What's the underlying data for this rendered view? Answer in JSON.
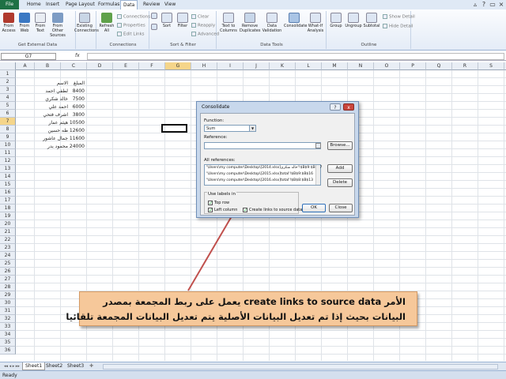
{
  "ribbon_tabs": [
    "File",
    "Home",
    "Insert",
    "Page Layout",
    "Formulas",
    "Data",
    "Review",
    "View"
  ],
  "ribbon": {
    "groups": {
      "get_external_data": "Get External Data",
      "connections": "Connections",
      "sort_filter": "Sort & Filter",
      "data_tools": "Data Tools",
      "outline": "Outline"
    },
    "buttons": {
      "from_access": "From Access",
      "from_web": "From Web",
      "from_text": "From Text",
      "from_other": "From Other Sources",
      "existing_connections": "Existing Connections",
      "refresh_all": "Refresh All",
      "sort": "Sort",
      "filter": "Filter",
      "text_to_columns": "Text to Columns",
      "remove_duplicates": "Remove Duplicates",
      "data_validation": "Data Validation",
      "consolidate": "Consolidate",
      "what_if": "What-If Analysis",
      "group": "Group",
      "ungroup": "Ungroup",
      "subtotal": "Subtotal"
    },
    "small": {
      "connections": "Connections",
      "properties": "Properties",
      "edit_links": "Edit Links",
      "clear": "Clear",
      "reapply": "Reapply",
      "advanced": "Advanced",
      "show_detail": "Show Detail",
      "hide_detail": "Hide Detail"
    }
  },
  "name_box": "G7",
  "fx": "fx",
  "columns": [
    "A",
    "B",
    "C",
    "D",
    "E",
    "F",
    "G",
    "H",
    "I",
    "J",
    "K",
    "L",
    "M",
    "N",
    "O",
    "P",
    "Q",
    "R",
    "S",
    "T"
  ],
  "rows": [
    "1",
    "2",
    "3",
    "4",
    "5",
    "6",
    "7",
    "8",
    "9",
    "10",
    "11",
    "12",
    "13",
    "14",
    "15",
    "16",
    "17",
    "18",
    "19",
    "20",
    "21",
    "22",
    "23",
    "24",
    "25",
    "26",
    "27",
    "28",
    "29",
    "30",
    "31",
    "32",
    "33",
    "34",
    "35",
    "36"
  ],
  "table": {
    "header": {
      "name": "الاسم",
      "amount": "المبلغ"
    },
    "rows": [
      {
        "name": "لطفي احمد",
        "amount": "8400"
      },
      {
        "name": "خالد شكري",
        "amount": "7500"
      },
      {
        "name": "احمد علي",
        "amount": "6000"
      },
      {
        "name": "اشرف فتحي",
        "amount": "3800"
      },
      {
        "name": "هيثم عمار",
        "amount": "10500"
      },
      {
        "name": "طه حسين",
        "amount": "12600"
      },
      {
        "name": "جمال عاشور",
        "amount": "11600"
      },
      {
        "name": "محمود بدر",
        "amount": "24000"
      }
    ]
  },
  "sheets": [
    "Sheet1",
    "Sheet2",
    "Sheet3"
  ],
  "status": "Ready",
  "dialog": {
    "title": "Consolidate",
    "help": "?",
    "close": "x",
    "function_label": "Function:",
    "function_value": "Sum",
    "reference_label": "Reference:",
    "reference_value": "",
    "browse": "Browse...",
    "all_references_label": "All references:",
    "references": [
      "'\\Users\\my computer\\Desktop\\[2014.xlsx]خالد شكري'!$B$9:$B$17",
      "'\\Users\\my computer\\Desktop\\[2015.xlsx]total'!$B$9:$B$16",
      "'\\Users\\my computer\\Desktop\\[2016.xlsx]total'!$B$8:$B$13"
    ],
    "add": "Add",
    "delete": "Delete",
    "use_labels": "Use labels in",
    "top_row": "Top row",
    "left_column": "Left column",
    "create_links": "Create links to source data",
    "ok": "OK",
    "close_btn": "Close"
  },
  "annotation": {
    "line1": "الأمر create links to source data يعمل على ربط المجمعة بمصدر",
    "line2": "البيانات بحيث إذا تم تعديل البيانات الأصلية يتم تعديل البيانات المجمعة تلقائيا"
  },
  "colors": {
    "excel_green": "#1e7145",
    "annotation_fill": "#f6c89a",
    "arrow": "#c0504d",
    "selection": "#f5d58a"
  }
}
